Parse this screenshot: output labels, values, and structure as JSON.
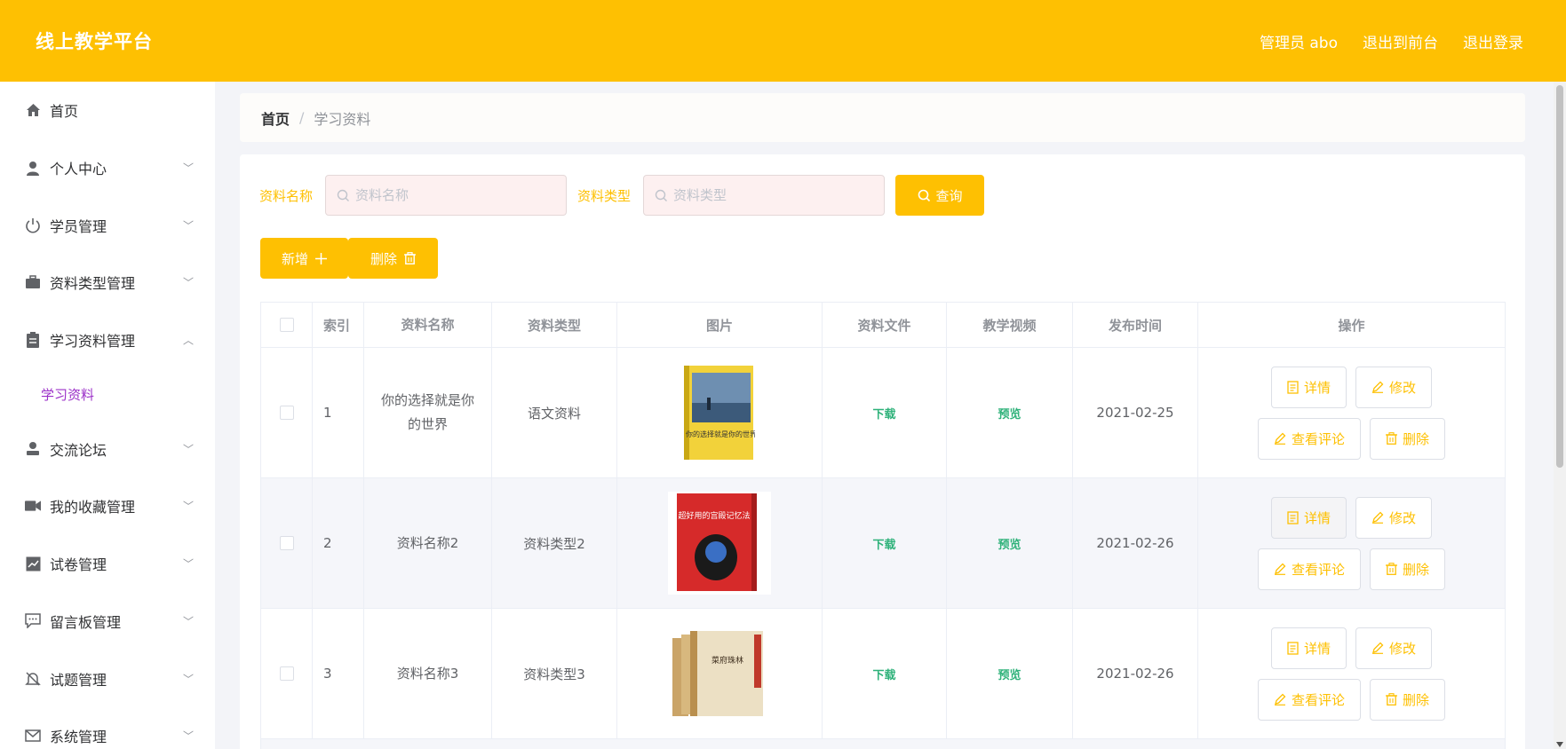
{
  "header": {
    "brand": "线上教学平台",
    "admin": "管理员 abo",
    "exit_front": "退出到前台",
    "logout": "退出登录"
  },
  "sidebar": {
    "items": [
      {
        "label": "首页",
        "icon": "home-icon",
        "expandable": false
      },
      {
        "label": "个人中心",
        "icon": "user-icon",
        "expandable": true,
        "expanded": false
      },
      {
        "label": "学员管理",
        "icon": "power-icon",
        "expandable": true,
        "expanded": false
      },
      {
        "label": "资料类型管理",
        "icon": "briefcase-icon",
        "expandable": true,
        "expanded": false
      },
      {
        "label": "学习资料管理",
        "icon": "clipboard-icon",
        "expandable": true,
        "expanded": true
      },
      {
        "label": "交流论坛",
        "icon": "person-stamp-icon",
        "expandable": true,
        "expanded": false
      },
      {
        "label": "我的收藏管理",
        "icon": "video-camera-icon",
        "expandable": true,
        "expanded": false
      },
      {
        "label": "试卷管理",
        "icon": "chart-icon",
        "expandable": true,
        "expanded": false
      },
      {
        "label": "留言板管理",
        "icon": "chat-icon",
        "expandable": true,
        "expanded": false
      },
      {
        "label": "试题管理",
        "icon": "bell-off-icon",
        "expandable": true,
        "expanded": false
      },
      {
        "label": "系统管理",
        "icon": "mail-icon",
        "expandable": true,
        "expanded": false
      }
    ],
    "active_sub": "学习资料"
  },
  "breadcrumb": {
    "home": "首页",
    "sep": "/",
    "current": "学习资料"
  },
  "search": {
    "name_label": "资料名称",
    "name_placeholder": "资料名称",
    "type_label": "资料类型",
    "type_placeholder": "资料类型",
    "button": "查询"
  },
  "actions": {
    "add": "新增",
    "delete": "删除"
  },
  "table": {
    "headers": [
      "索引",
      "资料名称",
      "资料类型",
      "图片",
      "资料文件",
      "教学视频",
      "发布时间",
      "操作"
    ],
    "rows": [
      {
        "index": "1",
        "name": "你的选择就是你的世界",
        "type": "语文资料",
        "file": "下载",
        "video": "预览",
        "date": "2021-02-25",
        "cover_title": "你的选择就是你的世界"
      },
      {
        "index": "2",
        "name": "资料名称2",
        "type": "资料类型2",
        "file": "下载",
        "video": "预览",
        "date": "2021-02-26",
        "cover_title": "超好用的宫殿记忆法"
      },
      {
        "index": "3",
        "name": "资料名称3",
        "type": "资料类型3",
        "file": "下载",
        "video": "预览",
        "date": "2021-02-26",
        "cover_title": "菜府珠林"
      }
    ],
    "ops": {
      "detail": "详情",
      "edit": "修改",
      "comments": "查看评论",
      "delete": "删除"
    }
  },
  "colors": {
    "primary": "#fec002",
    "link": "#2fb27a",
    "submenu_active": "#9b30c8"
  }
}
